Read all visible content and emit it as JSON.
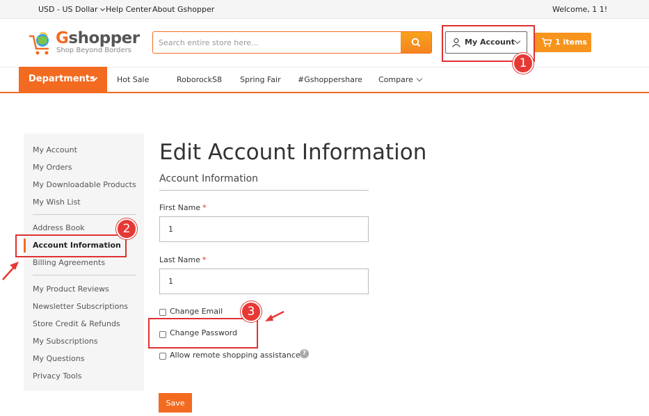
{
  "topbar": {
    "currency": "USD - US Dollar",
    "help_center": "Help Center",
    "about": "About Gshopper",
    "welcome": "Welcome, 1 1!"
  },
  "header": {
    "logo_text_g": "G",
    "logo_text_rest": "shopper",
    "logo_tagline": "Shop Beyond Borders",
    "search_placeholder": "Search entire store here...",
    "account_label": "My Account",
    "cart_label": "1 items"
  },
  "nav": {
    "departments": "Departments",
    "links": [
      "Hot Sale",
      "RoborockS8",
      "Spring Fair",
      "#Gshoppershare",
      "Compare"
    ]
  },
  "sidebar": {
    "items": [
      "My Account",
      "My Orders",
      "My Downloadable Products",
      "My Wish List",
      "Address Book",
      "Account Information",
      "Billing Agreements",
      "My Product Reviews",
      "Newsletter Subscriptions",
      "Store Credit & Refunds",
      "My Subscriptions",
      "My Questions",
      "Privacy Tools"
    ],
    "active": "Account Information"
  },
  "form": {
    "page_title": "Edit Account Information",
    "section_title": "Account Information",
    "first_name_label": "First Name",
    "first_name_value": "1",
    "last_name_label": "Last Name",
    "last_name_value": "1",
    "required_mark": "*",
    "change_email": "Change Email",
    "change_password": "Change Password",
    "remote_assist": "Allow remote shopping assistance",
    "help_glyph": "?",
    "save": "Save"
  },
  "annotations": {
    "step1": "1",
    "step2": "2",
    "step3": "3"
  },
  "colors": {
    "brand_orange": "#f26b21",
    "annotation_red": "#e53935"
  }
}
